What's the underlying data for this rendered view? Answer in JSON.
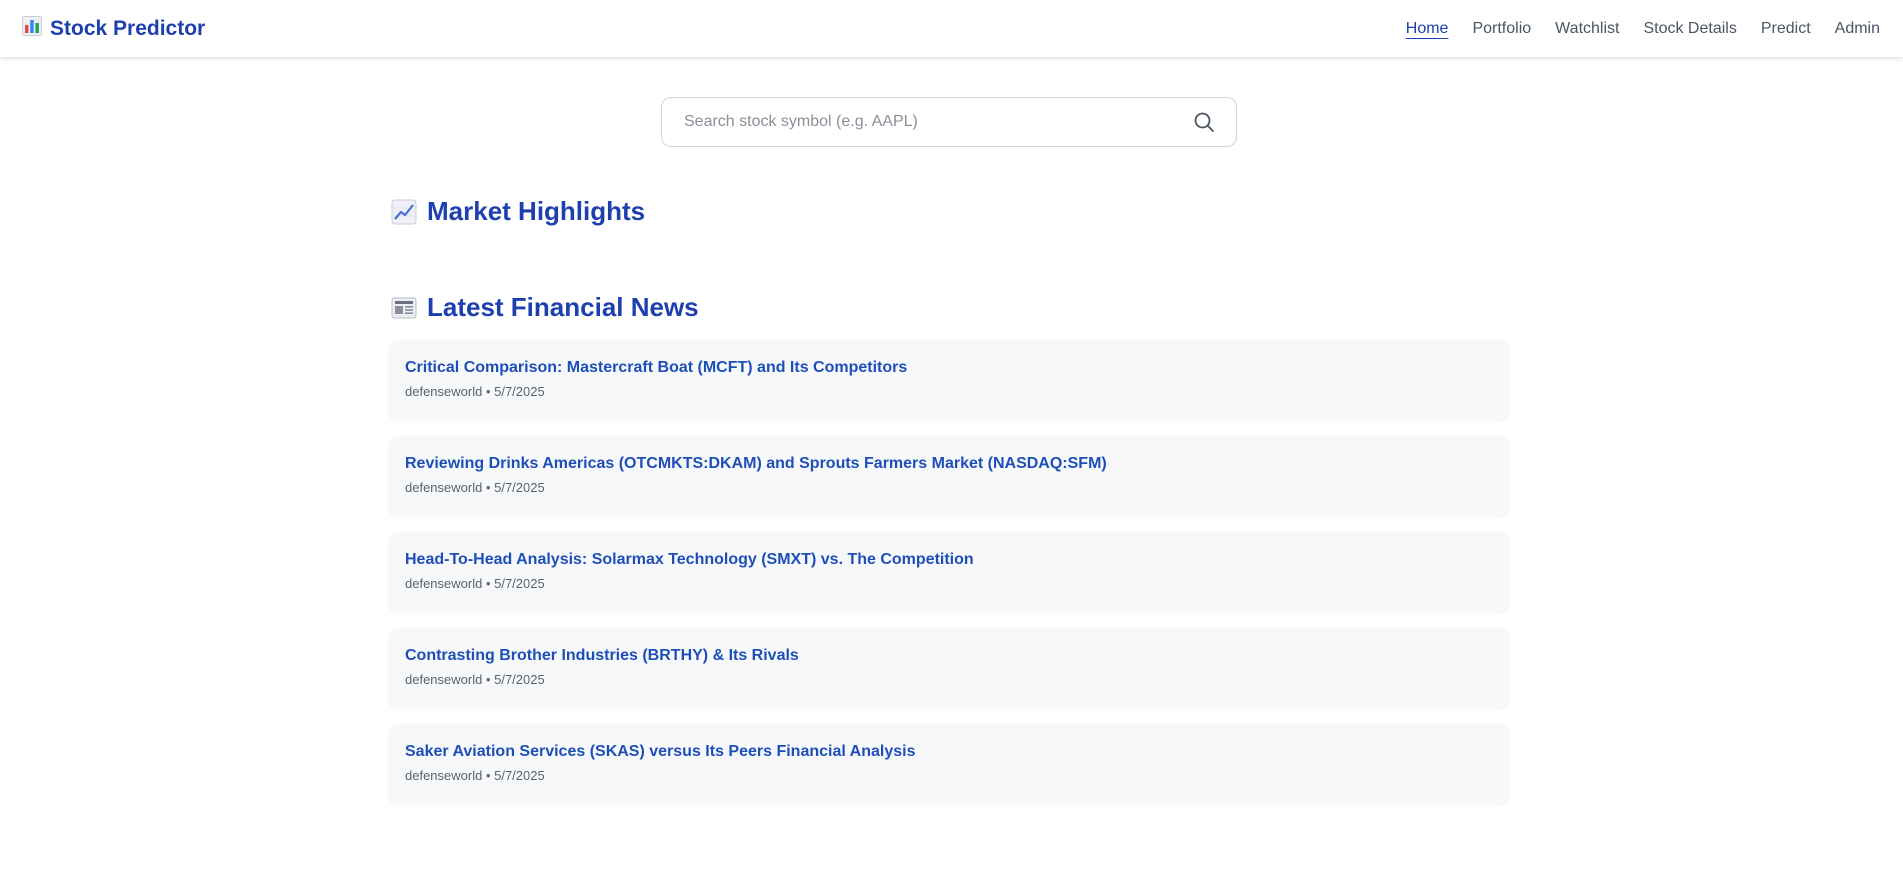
{
  "app": {
    "brand_icon": "bar-chart-icon",
    "brand_name": "Stock Predictor"
  },
  "nav": {
    "items": [
      {
        "label": "Home",
        "active": true
      },
      {
        "label": "Portfolio",
        "active": false
      },
      {
        "label": "Watchlist",
        "active": false
      },
      {
        "label": "Stock Details",
        "active": false
      },
      {
        "label": "Predict",
        "active": false
      },
      {
        "label": "Admin",
        "active": false
      }
    ]
  },
  "search": {
    "placeholder": "Search stock symbol (e.g. AAPL)",
    "value": "",
    "icon": "search-icon"
  },
  "market_highlights": {
    "icon": "trending-chart-icon",
    "title": "Market Highlights"
  },
  "news": {
    "icon": "newspaper-icon",
    "title": "Latest Financial News",
    "items": [
      {
        "title": "Critical Comparison: Mastercraft Boat (MCFT) and Its Competitors",
        "source": "defenseworld",
        "date": "5/7/2025",
        "meta": "defenseworld • 5/7/2025"
      },
      {
        "title": "Reviewing Drinks Americas (OTCMKTS:DKAM) and Sprouts Farmers Market (NASDAQ:SFM)",
        "source": "defenseworld",
        "date": "5/7/2025",
        "meta": "defenseworld • 5/7/2025"
      },
      {
        "title": "Head-To-Head Analysis: Solarmax Technology (SMXT) vs. The Competition",
        "source": "defenseworld",
        "date": "5/7/2025",
        "meta": "defenseworld • 5/7/2025"
      },
      {
        "title": "Contrasting Brother Industries (BRTHY) & Its Rivals",
        "source": "defenseworld",
        "date": "5/7/2025",
        "meta": "defenseworld • 5/7/2025"
      },
      {
        "title": "Saker Aviation Services (SKAS) versus Its Peers Financial Analysis",
        "source": "defenseworld",
        "date": "5/7/2025",
        "meta": "defenseworld • 5/7/2025"
      }
    ]
  },
  "colors": {
    "brand": "#1e40af",
    "link": "#1e4fb8",
    "nav_text": "#4b5563",
    "card_bg": "#f7f8fa"
  }
}
